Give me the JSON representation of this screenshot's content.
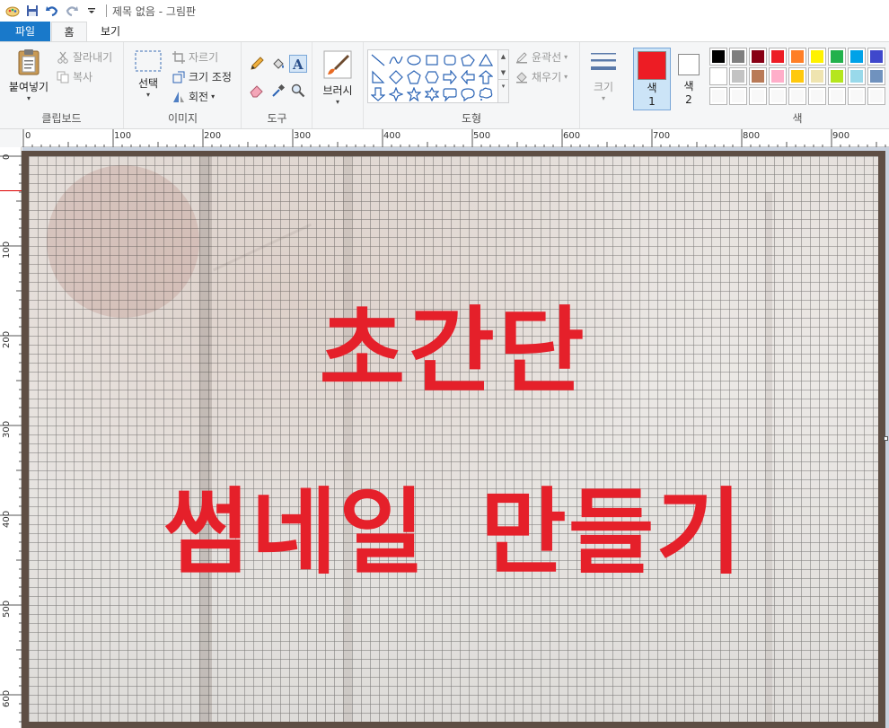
{
  "title_bar": {
    "title": "제목 없음 - 그림판",
    "quick_access": [
      "paint-app-icon",
      "save-icon",
      "undo-icon",
      "redo-icon",
      "customize-dropdown-icon"
    ]
  },
  "tabs": [
    {
      "label": "파일",
      "active": false
    },
    {
      "label": "홈",
      "active": true
    },
    {
      "label": "보기",
      "active": false
    }
  ],
  "ribbon": {
    "clipboard": {
      "label": "클립보드",
      "paste": "붙여넣기",
      "cut": "잘라내기",
      "copy": "복사"
    },
    "image": {
      "label": "이미지",
      "select": "선택",
      "crop": "자르기",
      "resize": "크기 조정",
      "rotate": "회전"
    },
    "tools": {
      "label": "도구"
    },
    "brushes": "브러시",
    "shapes": {
      "label": "도형",
      "outline": "윤곽선",
      "fill": "채우기"
    },
    "size": "크기",
    "color1": {
      "label": "색",
      "num": "1",
      "value": "#ed1c24"
    },
    "color2": {
      "label": "색",
      "num": "2",
      "value": "#ffffff"
    },
    "colors_label": "색",
    "palette": [
      "#000000",
      "#7f7f7f",
      "#880015",
      "#ed1c24",
      "#ff7f27",
      "#fff200",
      "#22b14c",
      "#00a2e8",
      "#3f48cc",
      "#ffffff",
      "#c3c3c3",
      "#b97a57",
      "#ffaec9",
      "#ffc90e",
      "#efe4b0",
      "#b5e61d",
      "#99d9ea",
      "#7092be",
      "#f8f8f8",
      "#f8f8f8",
      "#f8f8f8",
      "#f8f8f8",
      "#f8f8f8",
      "#f8f8f8",
      "#f8f8f8",
      "#f8f8f8",
      "#f8f8f8"
    ]
  },
  "ruler": {
    "top": [
      "0",
      "100",
      "200",
      "300",
      "400",
      "500",
      "600",
      "700",
      "800",
      "900"
    ],
    "left": [
      "0",
      "100",
      "200",
      "300",
      "400",
      "500",
      "600"
    ]
  },
  "canvas": {
    "line1": "초간단",
    "line2": "썸네일 만들기",
    "text_color": "#e5202a"
  }
}
